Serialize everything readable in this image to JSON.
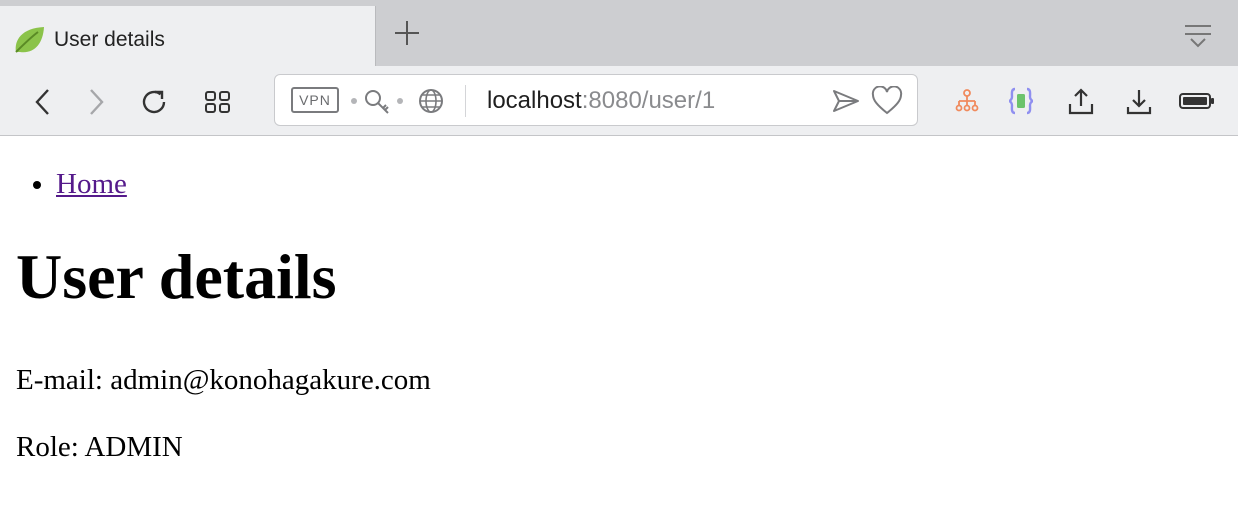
{
  "browser": {
    "tab": {
      "title": "User details",
      "favicon": "spring-leaf-icon"
    },
    "url": {
      "host": "localhost",
      "rest": ":8080/user/1"
    },
    "vpn_label": "VPN",
    "icons": {
      "back": "chevron-left-icon",
      "forward": "chevron-right-icon",
      "reload": "reload-icon",
      "speed_dial": "grid-icon",
      "new_tab": "plus-icon",
      "tab_menu": "tab-menu-icon",
      "key": "key-icon",
      "globe": "globe-icon",
      "send": "send-icon",
      "bookmark": "heart-icon",
      "sitemap_ext": "sitemap-icon",
      "json_ext": "braces-icon",
      "share": "share-icon",
      "download": "download-icon",
      "battery": "battery-icon"
    },
    "colors": {
      "tab_bg": "#eeeff1",
      "strip_bg": "#cdced1",
      "link": "#551a8b",
      "leaf": "#8bc34a"
    }
  },
  "page": {
    "nav": [
      {
        "label": "Home"
      }
    ],
    "heading": "User details",
    "email_line": "E-mail: admin@konohagakure.com",
    "role_line": "Role: ADMIN"
  }
}
